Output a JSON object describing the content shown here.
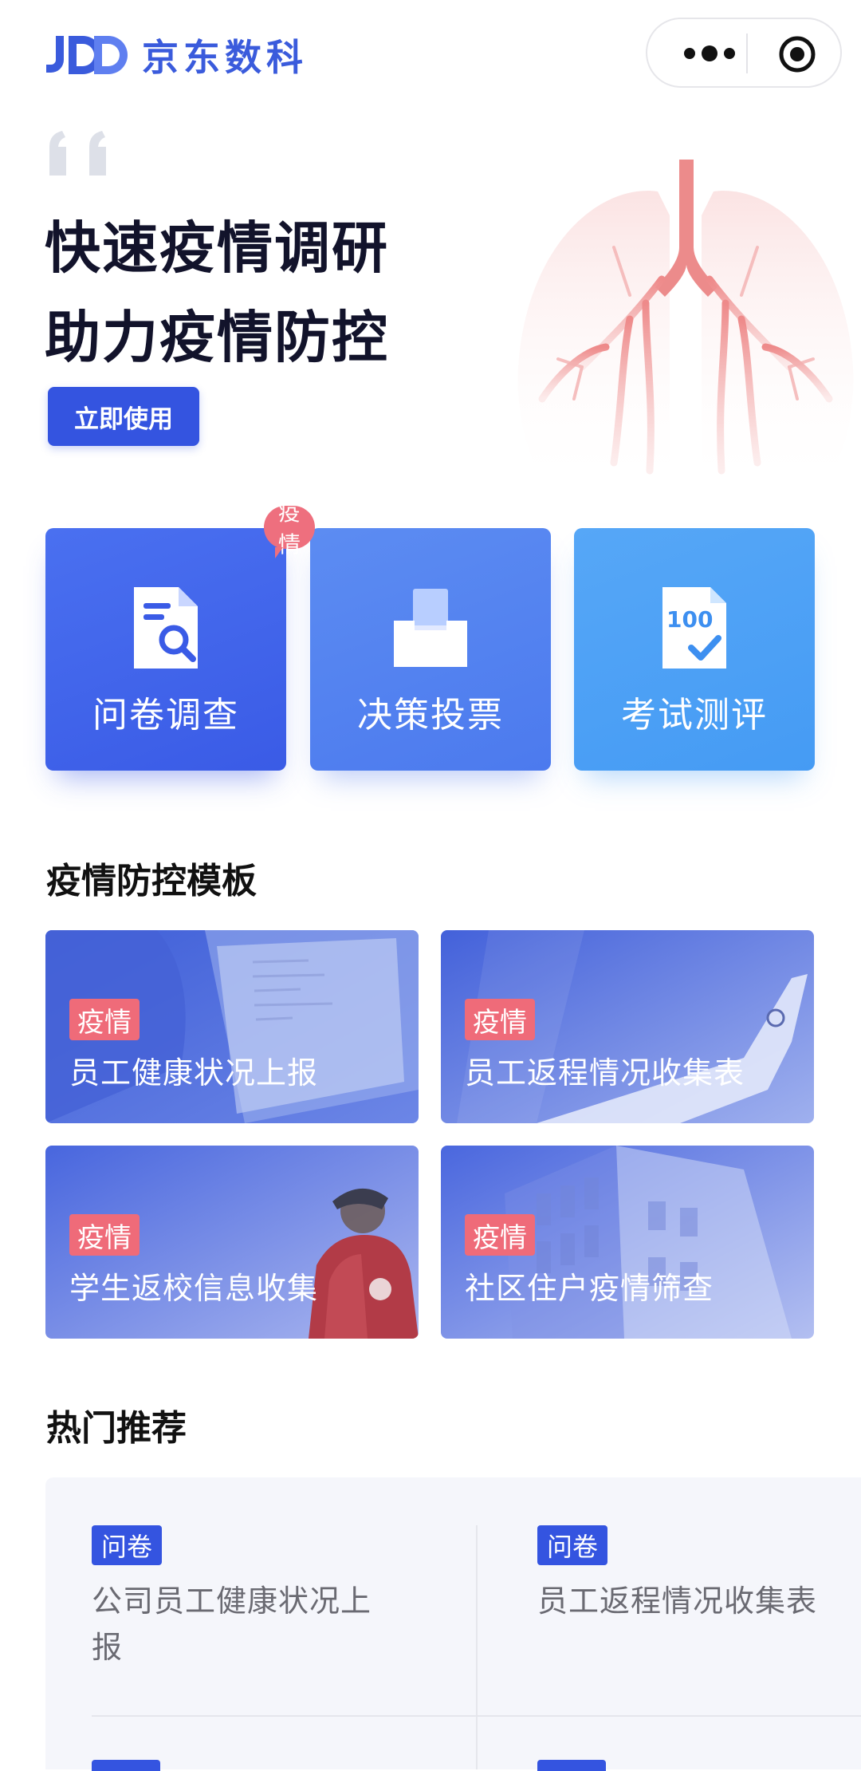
{
  "header": {
    "logo_mark": "JDD",
    "brand": "京东数科",
    "more_icon": "more-dots-icon",
    "close_icon": "target-circle-icon"
  },
  "hero": {
    "title_line1": "快速疫情调研",
    "title_line2": "助力疫情防控",
    "cta_label": "立即使用",
    "accent": "#3454e0"
  },
  "tiles": [
    {
      "label": "问卷调查",
      "icon": "document-search-icon",
      "badge": "疫情"
    },
    {
      "label": "决策投票",
      "icon": "ballot-box-icon"
    },
    {
      "label": "考试测评",
      "icon": "exam-score-icon",
      "icon_text": "100"
    }
  ],
  "templates": {
    "title": "疫情防控模板",
    "items": [
      {
        "tag": "疫情",
        "name": "员工健康状况上报"
      },
      {
        "tag": "疫情",
        "name": "员工返程情况收集表"
      },
      {
        "tag": "疫情",
        "name": "学生返校信息收集"
      },
      {
        "tag": "疫情",
        "name": "社区住户疫情筛查"
      }
    ]
  },
  "hot": {
    "title": "热门推荐",
    "items": [
      {
        "tag": "问卷",
        "title": "公司员工健康状况上报"
      },
      {
        "tag": "问卷",
        "title": "员工返程情况收集表"
      }
    ]
  },
  "colors": {
    "primary": "#3454e0",
    "tag_red": "#ef6b79",
    "tile_blue_1": "#4a70f0",
    "tile_blue_2": "#5c8cf2",
    "tile_blue_3": "#56a7f7"
  }
}
